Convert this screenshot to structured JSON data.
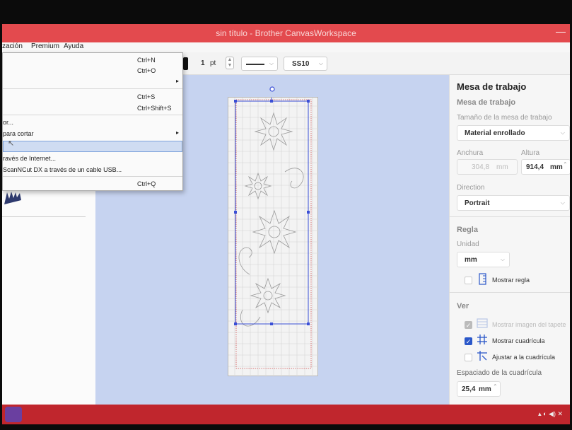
{
  "window": {
    "title": "sin título - Brother CanvasWorkspace"
  },
  "menubar": {
    "items": [
      "zación",
      "Premium",
      "Ayuda"
    ]
  },
  "toolbar": {
    "line_width": "1",
    "line_width_unit": "pt",
    "font_value": "SS10"
  },
  "file_menu": {
    "items": [
      {
        "label": "",
        "shortcut": "Ctrl+N"
      },
      {
        "label": "",
        "shortcut": "Ctrl+O"
      },
      {
        "label": "",
        "shortcut": "",
        "submenu": true
      },
      {
        "label": "",
        "shortcut": "Ctrl+S"
      },
      {
        "label": "",
        "shortcut": "Ctrl+Shift+S"
      },
      {
        "label": "or...",
        "shortcut": ""
      },
      {
        "label": "para cortar",
        "shortcut": "",
        "submenu": true
      },
      {
        "label": "",
        "shortcut": "",
        "highlighted": true
      },
      {
        "label": "ravés de Internet...",
        "shortcut": ""
      },
      {
        "label": "ScanNCut DX a través de un cable USB...",
        "shortcut": ""
      },
      {
        "label": "",
        "shortcut": "Ctrl+Q"
      }
    ]
  },
  "right_panel": {
    "title": "Mesa de trabajo",
    "subtitle": "Mesa de trabajo",
    "mat_size_label": "Tamaño de la mesa de trabajo",
    "mat_size_value": "Material enrollado",
    "width_label": "Anchura",
    "width_value": "304,8",
    "width_unit": "mm",
    "height_label": "Altura",
    "height_value": "914,4",
    "height_unit": "mm",
    "direction_label": "Direction",
    "direction_value": "Portrait",
    "ruler_section": "Regla",
    "unit_label": "Unidad",
    "unit_value": "mm",
    "show_ruler_label": "Mostrar regla",
    "show_ruler_checked": false,
    "view_section": "Ver",
    "show_mat_image_label": "Mostrar imagen del tapete",
    "show_mat_image_checked": true,
    "show_grid_label": "Mostrar cuadrícula",
    "show_grid_checked": true,
    "snap_grid_label": "Ajustar a la cuadrícula",
    "snap_grid_checked": false,
    "grid_spacing_label": "Espaciado de la cuadrícula",
    "grid_spacing_value": "25,4",
    "grid_spacing_unit": "mm"
  },
  "colors": {
    "titlebar": "#e34a4e",
    "canvas_bg": "#c6d3f0",
    "selection": "#3a4fd6",
    "accent": "#2a57c9",
    "taskbar": "#c0262d"
  }
}
